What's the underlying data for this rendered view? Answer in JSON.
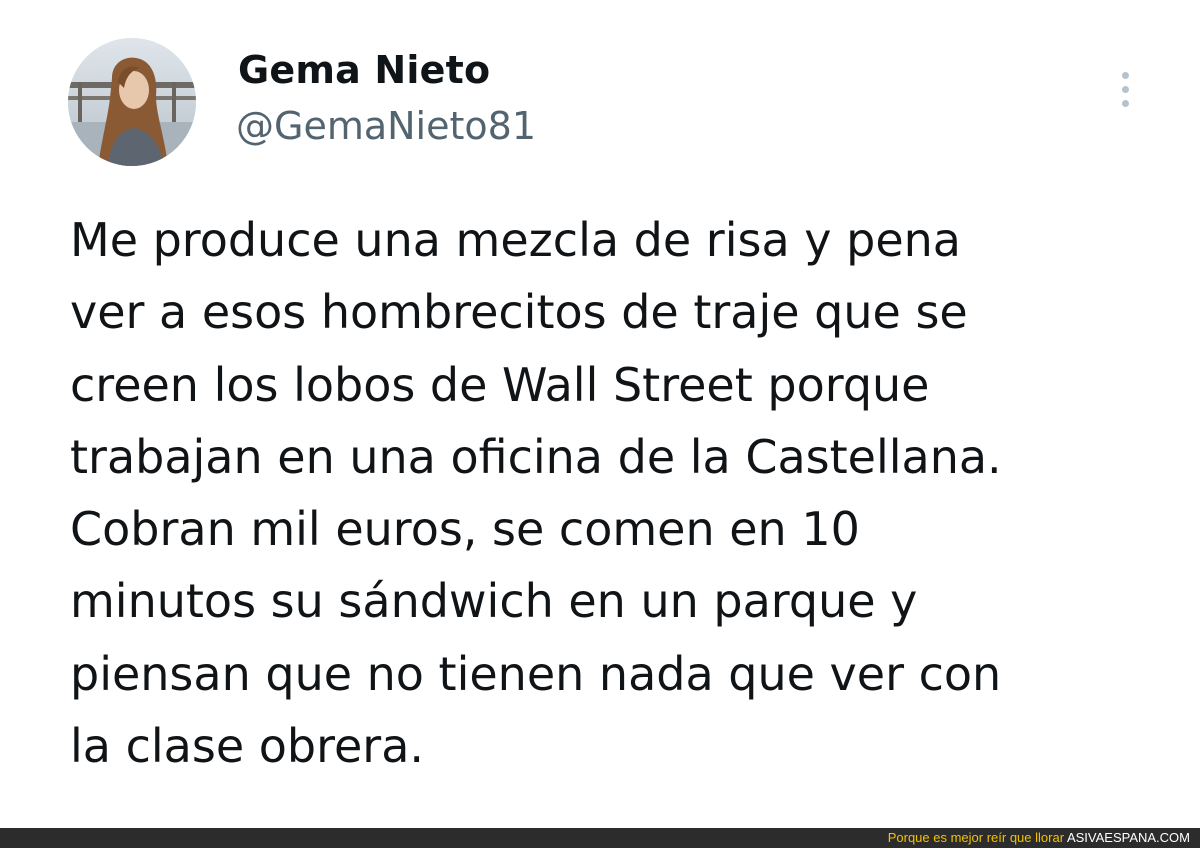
{
  "tweet": {
    "avatar_icon": "user-avatar-photo",
    "display_name": "Gema Nieto",
    "handle": "@GemaNieto81",
    "more_icon": "more-options-vertical-icon",
    "body_lines": [
      "Me produce una mezcla de risa y pena",
      "ver a esos hombrecitos de traje que se",
      "creen los lobos de Wall Street porque",
      "trabajan en una oficina de la Castellana.",
      "Cobran mil euros, se comen en 10",
      "minutos su sándwich en un parque y",
      "piensan que no tienen nada que ver con",
      "la clase obrera."
    ]
  },
  "footer": {
    "slogan": "Porque es mejor reír que llorar",
    "site": "ASIVAESPANA.COM"
  },
  "colors": {
    "text": "#0f1419",
    "handle": "#536471",
    "footer_bg": "#2c2c2c",
    "slogan": "#f2c200",
    "site": "#ffffff"
  }
}
